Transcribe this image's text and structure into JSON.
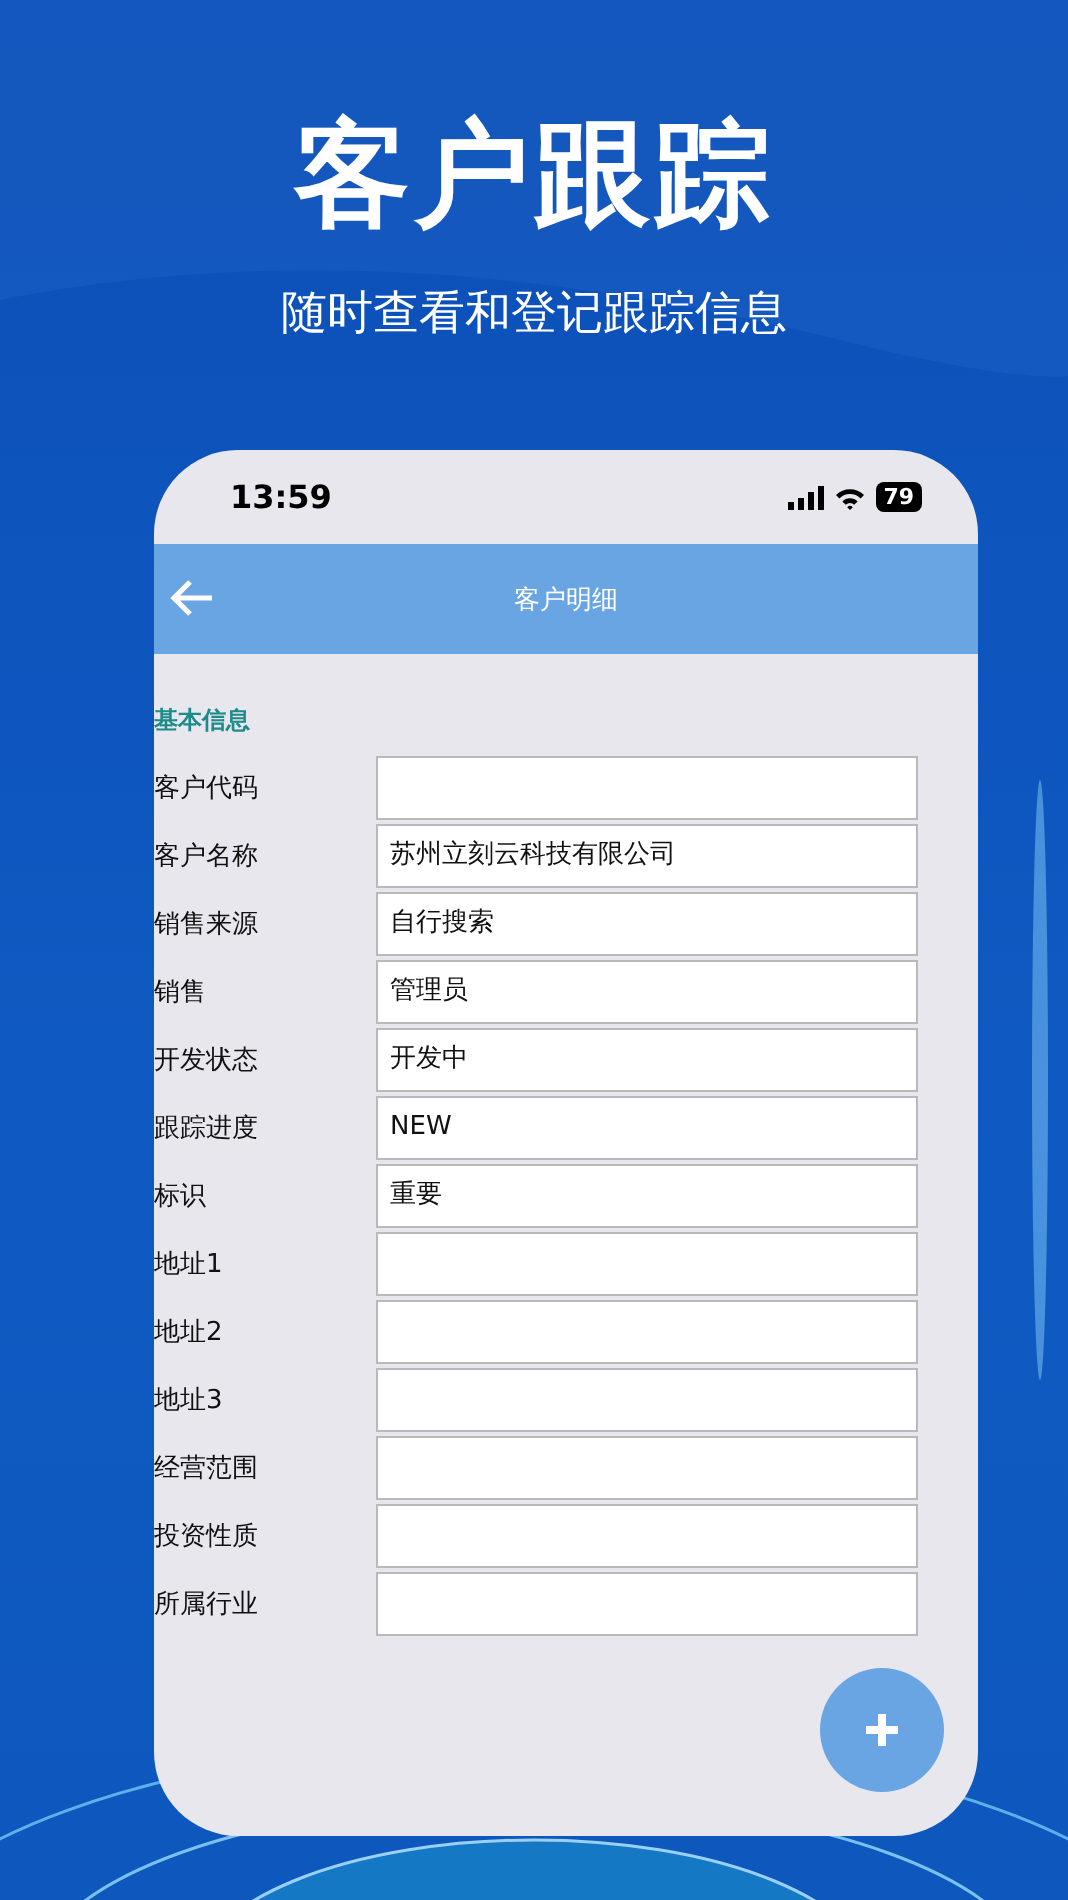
{
  "headline": "客户跟踪",
  "subheadline": "随时查看和登记跟踪信息",
  "status_bar": {
    "time": "13:59",
    "battery": "79"
  },
  "app_bar": {
    "title": "客户明细"
  },
  "section_title": "基本信息",
  "fields": [
    {
      "label": "客户代码"
    },
    {
      "label": "客户名称",
      "value": "苏州立刻云科技有限公司"
    },
    {
      "label": "销售来源",
      "value": "自行搜索"
    },
    {
      "label": "销售",
      "value": "管理员"
    },
    {
      "label": "开发状态",
      "value": "开发中"
    },
    {
      "label": "跟踪进度",
      "value": "NEW"
    },
    {
      "label": "标识",
      "value": "重要"
    },
    {
      "label": "地址1"
    },
    {
      "label": "地址2"
    },
    {
      "label": "地址3"
    },
    {
      "label": "经营范围"
    },
    {
      "label": "投资性质"
    },
    {
      "label": "所属行业"
    }
  ]
}
